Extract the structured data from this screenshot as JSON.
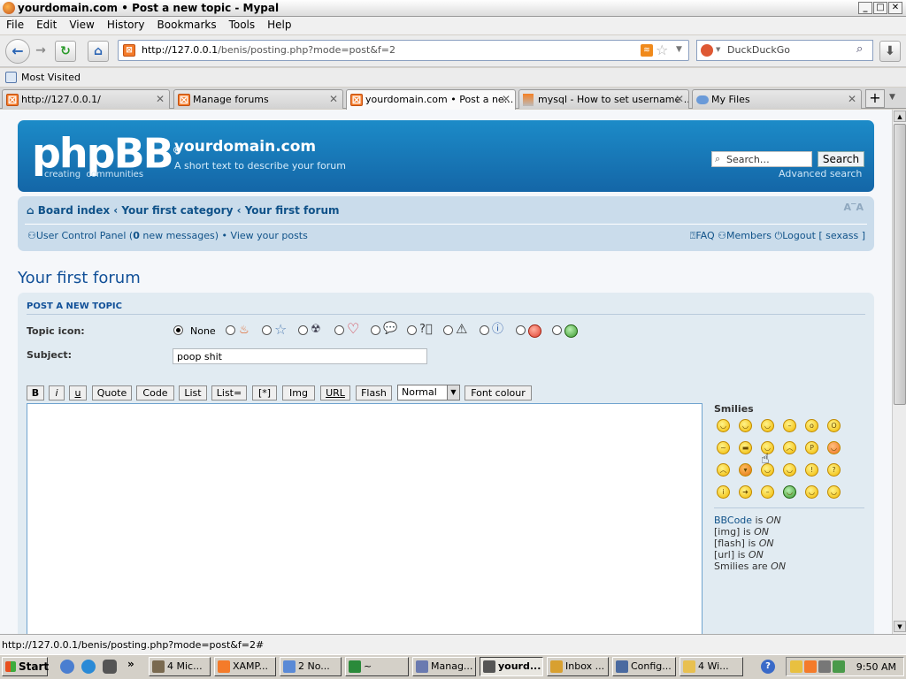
{
  "window": {
    "title": "yourdomain.com • Post a new topic - Mypal"
  },
  "menu": [
    "File",
    "Edit",
    "View",
    "History",
    "Bookmarks",
    "Tools",
    "Help"
  ],
  "url": "http://127.0.0.1/benis/posting.php?mode=post&f=2",
  "url_host": "http://127.0.0.1",
  "url_path": "/benis/posting.php?mode=post&f=2",
  "search_engine": "DuckDuckGo",
  "bookmarks": {
    "most_visited": "Most Visited"
  },
  "tabs": [
    {
      "label": "http://127.0.0.1/"
    },
    {
      "label": "Manage forums"
    },
    {
      "label": "yourdomain.com • Post a ne..."
    },
    {
      "label": "mysql - How to set username ..."
    },
    {
      "label": "My Files"
    }
  ],
  "forum": {
    "site_name": "yourdomain.com",
    "site_desc": "A short text to describe your forum",
    "search_placeholder": "Search…",
    "search_button": "Search",
    "advanced_search": "Advanced search",
    "crumbs": [
      "Board index",
      "Your first category",
      "Your first forum"
    ],
    "font_size": "A‾A",
    "ucp_label": "User Control Panel",
    "ucp_count": "0",
    "ucp_suffix": "new messages",
    "view_posts": "View your posts",
    "faq": "FAQ",
    "members": "Members",
    "logout": "Logout [ sexass ]",
    "page_title": "Your first forum",
    "panel_title": "POST A NEW TOPIC",
    "topic_icon_label": "Topic icon:",
    "topic_icon_none": "None",
    "subject_label": "Subject:",
    "subject_value": "poop shit",
    "bbcode_buttons": [
      "B",
      "i",
      "u",
      "Quote",
      "Code",
      "List",
      "List=",
      "[*]",
      "Img",
      "URL",
      "Flash"
    ],
    "font_size_select": "Normal",
    "font_colour": "Font colour",
    "smilies_title": "Smilies",
    "status": {
      "bbcode_link": "BBCode",
      "bbcode_is": " is ",
      "bbcode_state": "ON",
      "img": "[img] is ",
      "img_state": "ON",
      "flash": "[flash] is ",
      "flash_state": "ON",
      "url": "[url] is ",
      "url_state": "ON",
      "smilies": "Smilies are ",
      "smilies_state": "ON"
    }
  },
  "statusbar": "http://127.0.0.1/benis/posting.php?mode=post&f=2#",
  "taskbar": {
    "start": "Start",
    "items": [
      "4 Mic...",
      "XAMP...",
      "2 No...",
      "~",
      "Manag...",
      "yourd...",
      "Inbox ...",
      "Config...",
      "4 Wi..."
    ],
    "clock": "9:50 AM"
  },
  "colors": {
    "header_blue": "#1466a7",
    "link_blue": "#105289",
    "panel_bg": "#e1ebf2",
    "nav_bg": "#cadceb"
  }
}
